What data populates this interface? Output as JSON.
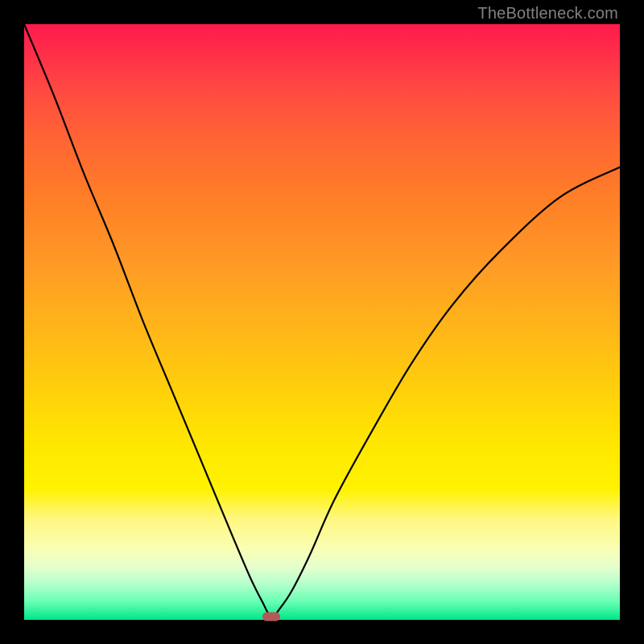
{
  "watermark": "TheBottleneck.com",
  "chart_data": {
    "type": "line",
    "title": "",
    "xlabel": "",
    "ylabel": "",
    "xlim": [
      0,
      100
    ],
    "ylim": [
      0,
      100
    ],
    "gradient_bands": [
      {
        "color": "#ff1a4d",
        "stop": 0
      },
      {
        "color": "#ff6633",
        "stop": 20
      },
      {
        "color": "#ffcc0d",
        "stop": 60
      },
      {
        "color": "#ffff66",
        "stop": 85
      },
      {
        "color": "#00e68a",
        "stop": 100
      }
    ],
    "series": [
      {
        "name": "bottleneck-curve",
        "x": [
          0,
          5,
          10,
          15,
          20,
          25,
          30,
          35,
          38,
          40,
          41.5,
          43,
          45,
          48,
          52,
          58,
          65,
          72,
          80,
          90,
          100
        ],
        "y": [
          100,
          88,
          75,
          63,
          50,
          38,
          26,
          14,
          7,
          3,
          0.5,
          2,
          5,
          11,
          20,
          31,
          43,
          53,
          62,
          71,
          76
        ]
      }
    ],
    "marker": {
      "x": 41.5,
      "y": 0.5,
      "shape": "rounded-rect",
      "color": "#b35959"
    }
  }
}
